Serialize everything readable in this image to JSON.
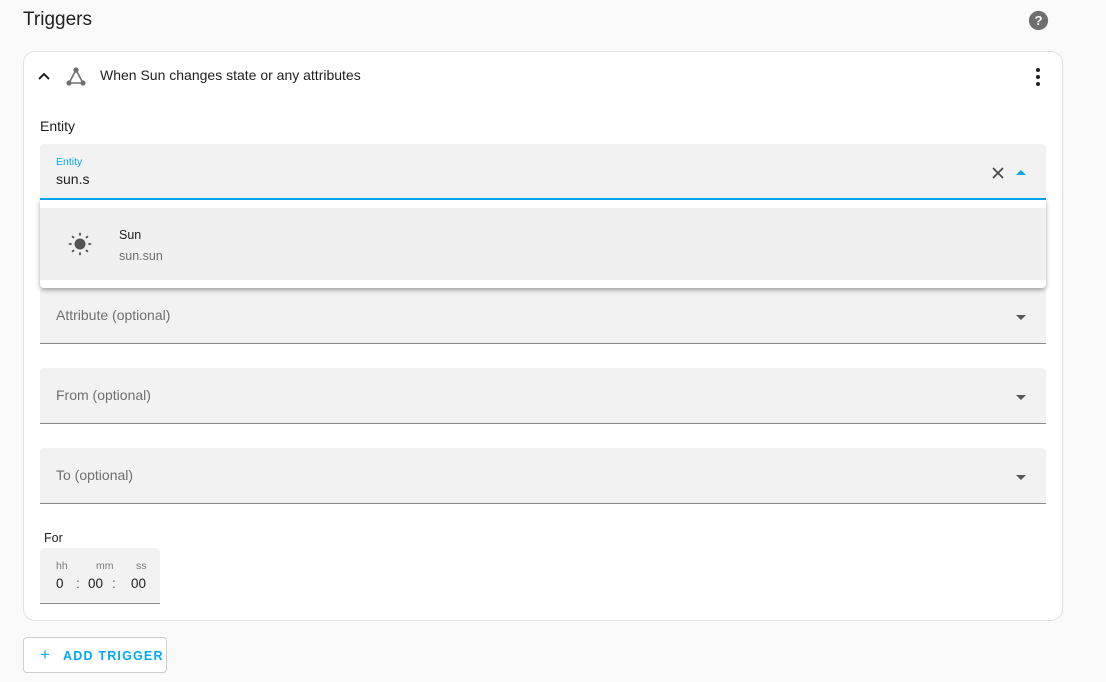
{
  "page_title": "Triggers",
  "icons": {
    "help": "help-circle-icon",
    "collapse": "chevron-up-icon",
    "trigger_type": "state-change-icon",
    "overflow": "more-vert-icon",
    "clear": "close-icon",
    "dropdown_arrow": "menu-down-icon",
    "sun": "weather-sunny-icon",
    "add": "plus-icon"
  },
  "colors": {
    "accent": "#03a9f4",
    "field_bg": "#f2f2f2",
    "page_bg": "#fafafa"
  },
  "trigger": {
    "title": "When Sun changes state or any attributes",
    "entity_section_label": "Entity",
    "entity_field": {
      "label": "Entity",
      "value": "sun.s"
    },
    "suggestions": [
      {
        "name": "Sun",
        "entity_id": "sun.sun"
      }
    ],
    "attribute_field": {
      "placeholder": "Attribute (optional)"
    },
    "from_field": {
      "placeholder": "From (optional)"
    },
    "to_field": {
      "placeholder": "To (optional)"
    },
    "for_label": "For",
    "duration": {
      "hours_label": "hh",
      "hours": "0",
      "minutes_label": "mm",
      "minutes": "00",
      "seconds_label": "ss",
      "seconds": "00",
      "separator": ":"
    }
  },
  "add_trigger_label": "ADD TRIGGER"
}
